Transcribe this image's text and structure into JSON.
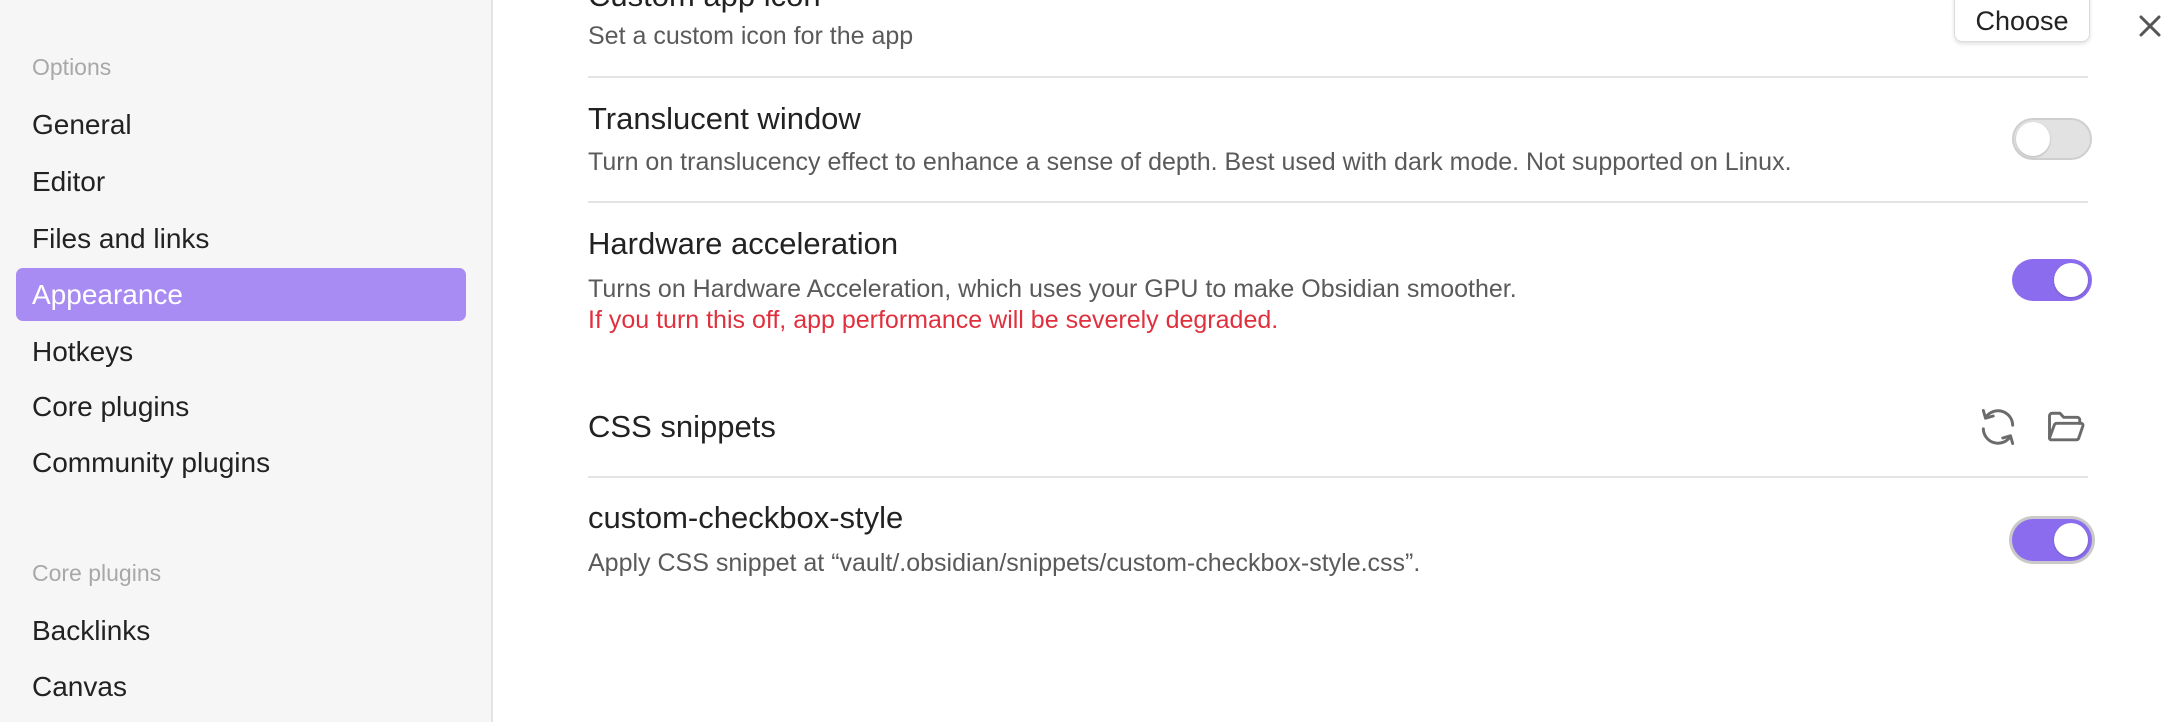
{
  "sidebar": {
    "options_heading": "Options",
    "options_items": [
      {
        "label": "General",
        "active": false
      },
      {
        "label": "Editor",
        "active": false
      },
      {
        "label": "Files and links",
        "active": false
      },
      {
        "label": "Appearance",
        "active": true
      },
      {
        "label": "Hotkeys",
        "active": false
      },
      {
        "label": "Core plugins",
        "active": false
      },
      {
        "label": "Community plugins",
        "active": false
      }
    ],
    "core_plugins_heading": "Core plugins",
    "core_plugins_items": [
      {
        "label": "Backlinks"
      },
      {
        "label": "Canvas"
      }
    ]
  },
  "settings": {
    "custom_app_icon": {
      "title": "Custom app icon",
      "description": "Set a custom icon for the app",
      "button_label": "Choose"
    },
    "translucent_window": {
      "title": "Translucent window",
      "description": "Turn on translucency effect to enhance a sense of depth. Best used with dark mode. Not supported on Linux.",
      "enabled": false
    },
    "hardware_acceleration": {
      "title": "Hardware acceleration",
      "description": "Turns on Hardware Acceleration, which uses your GPU to make Obsidian smoother.",
      "warning": "If you turn this off, app performance will be severely degraded.",
      "enabled": true
    },
    "css_snippets": {
      "heading": "CSS snippets",
      "reload_icon": "refresh-icon",
      "folder_icon": "folder-open-icon"
    },
    "snippet": {
      "title": "custom-checkbox-style",
      "description": "Apply CSS snippet at “vault/.obsidian/snippets/custom-checkbox-style.css”.",
      "enabled": true
    }
  },
  "colors": {
    "accent": "#8b6cef",
    "active_nav": "#a88bf3",
    "warning": "#e0303d"
  },
  "icons": {
    "close": "close-icon"
  }
}
